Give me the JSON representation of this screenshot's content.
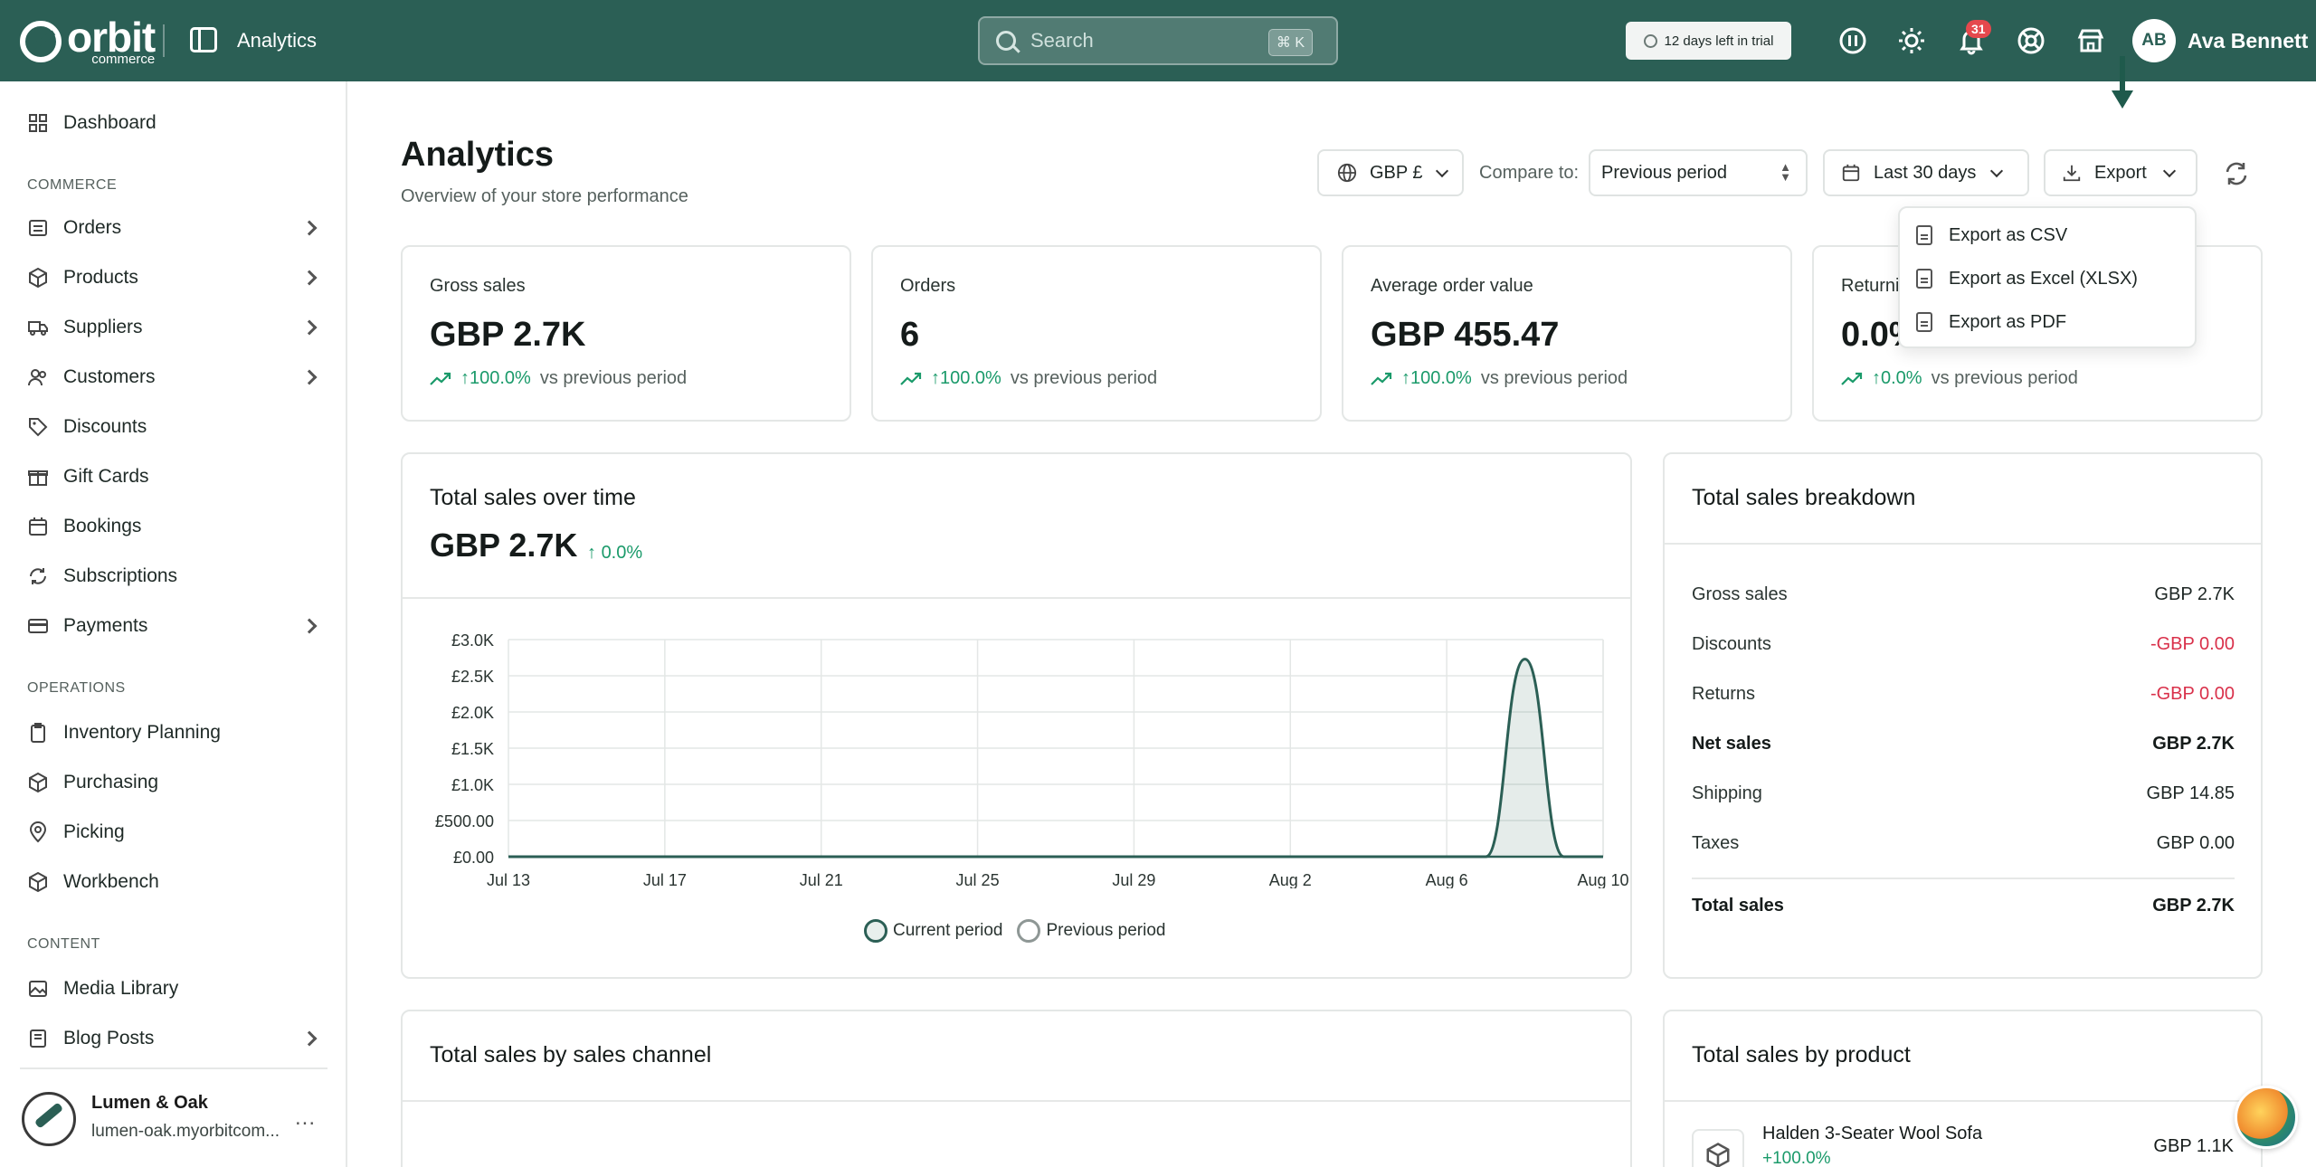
{
  "topbar": {
    "logo_text": "orbit",
    "logo_sub": "commerce",
    "section_title": "Analytics",
    "search_placeholder": "Search",
    "search_shortcut": "⌘ K",
    "trial_text": "12 days left in trial",
    "notification_count": "31",
    "avatar_initials": "AB",
    "user_name": "Ava Bennett"
  },
  "sidebar": {
    "dashboard": "Dashboard",
    "commerce_heading": "COMMERCE",
    "commerce_items": [
      "Orders",
      "Products",
      "Suppliers",
      "Customers",
      "Discounts",
      "Gift Cards",
      "Bookings",
      "Subscriptions",
      "Payments"
    ],
    "operations_heading": "OPERATIONS",
    "operations_items": [
      "Inventory Planning",
      "Purchasing",
      "Picking",
      "Workbench"
    ],
    "content_heading": "CONTENT",
    "content_items": [
      "Media Library",
      "Blog Posts"
    ],
    "store_name": "Lumen & Oak",
    "store_url": "lumen-oak.myorbitcom...",
    "store_menu": "..."
  },
  "page": {
    "title": "Analytics",
    "subtitle": "Overview of your store performance"
  },
  "controls": {
    "currency": "GBP £",
    "compare_label": "Compare to:",
    "compare_value": "Previous period",
    "date_range": "Last 30 days",
    "export_label": "Export"
  },
  "export_menu": [
    "Export as CSV",
    "Export as Excel (XLSX)",
    "Export as PDF"
  ],
  "metrics": [
    {
      "label": "Gross sales",
      "value": "GBP 2.7K",
      "change": "100.0%",
      "vs": "vs previous period"
    },
    {
      "label": "Orders",
      "value": "6",
      "change": "100.0%",
      "vs": "vs previous period"
    },
    {
      "label": "Average order value",
      "value": "GBP 455.47",
      "change": "100.0%",
      "vs": "vs previous period"
    },
    {
      "label": "Returning",
      "value": "0.0%",
      "change": "0.0%",
      "vs": "vs previous period"
    }
  ],
  "sales_chart": {
    "title": "Total sales over time",
    "value": "GBP 2.7K",
    "change": "0.0%",
    "legend_current": "Current period",
    "legend_previous": "Previous period"
  },
  "chart_data": {
    "type": "area",
    "title": "",
    "xlabel": "",
    "ylabel": "",
    "x_ticks": [
      "Jul 13",
      "Jul 17",
      "Jul 21",
      "Jul 25",
      "Jul 29",
      "Aug 2",
      "Aug 6",
      "Aug 10"
    ],
    "y_ticks": [
      "£0.00",
      "£500.00",
      "£1.0K",
      "£1.5K",
      "£2.0K",
      "£2.5K",
      "£3.0K"
    ],
    "ylim": [
      0,
      3000
    ],
    "x_day_range": [
      "Jul 13",
      "Aug 10"
    ],
    "series": [
      {
        "name": "Current period",
        "color": "#2b5f55",
        "x": [
          "Jul 13",
          "Aug 6",
          "Aug 7",
          "Aug 8",
          "Aug 9",
          "Aug 10"
        ],
        "values": [
          0,
          0,
          0,
          2730,
          0,
          0
        ]
      },
      {
        "name": "Previous period",
        "color": "#9aa3a1",
        "x": [
          "Jul 13",
          "Aug 10"
        ],
        "values": [
          0,
          0
        ]
      }
    ],
    "grid": true,
    "legend_position": "bottom"
  },
  "breakdown": {
    "title": "Total sales breakdown",
    "rows": [
      {
        "label": "Gross sales",
        "value": "GBP 2.7K"
      },
      {
        "label": "Discounts",
        "value": "-GBP 0.00"
      },
      {
        "label": "Returns",
        "value": "-GBP 0.00"
      },
      {
        "label": "Net sales",
        "value": "GBP 2.7K"
      },
      {
        "label": "Shipping",
        "value": "GBP 14.85"
      },
      {
        "label": "Taxes",
        "value": "GBP 0.00"
      },
      {
        "label": "Total sales",
        "value": "GBP 2.7K"
      }
    ]
  },
  "channel_card": {
    "title": "Total sales by sales channel"
  },
  "product_card": {
    "title": "Total sales by product",
    "product_name": "Halden 3-Seater Wool Sofa",
    "product_change": "+100.0%",
    "product_value": "GBP 1.1K"
  },
  "colors": {
    "brand": "#2b5f55",
    "positive": "#1a9a6a",
    "negative": "#d9304a"
  }
}
